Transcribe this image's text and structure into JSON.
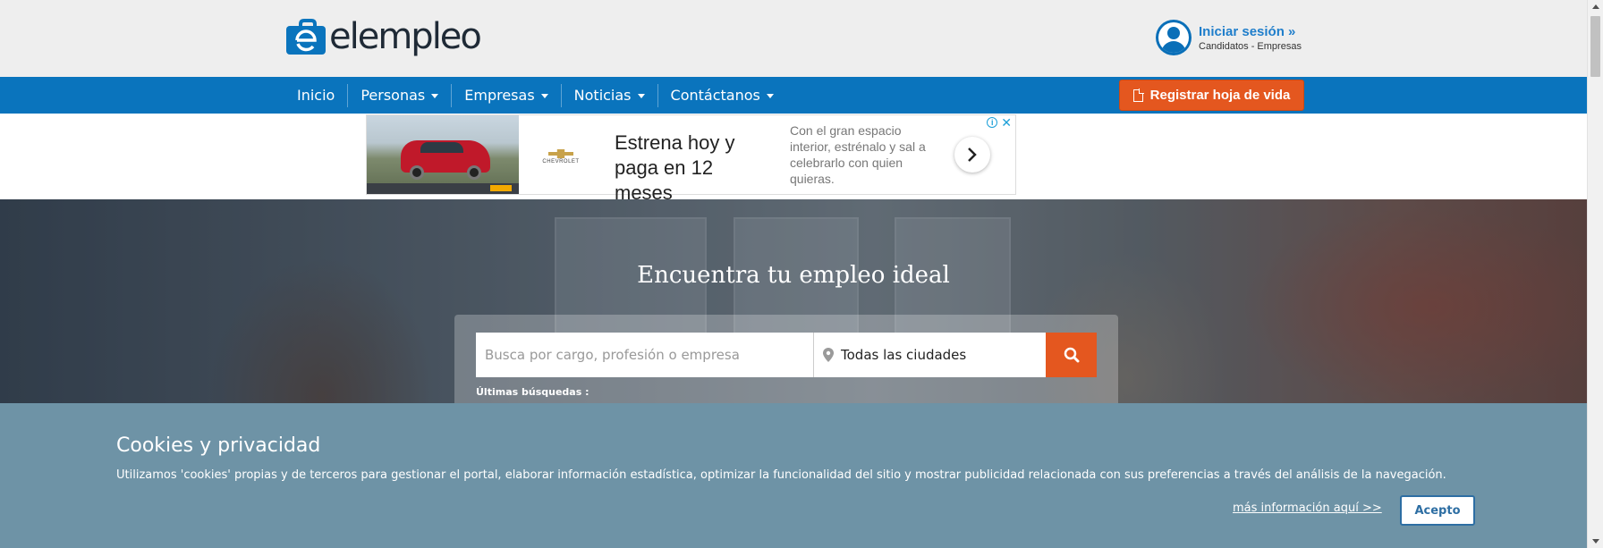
{
  "header": {
    "logo_text": "elempleo",
    "login_title": "Iniciar sesión »",
    "login_subtitle": "Candidatos - Empresas"
  },
  "nav": {
    "items": [
      {
        "label": "Inicio",
        "dropdown": false
      },
      {
        "label": "Personas",
        "dropdown": true
      },
      {
        "label": "Empresas",
        "dropdown": true
      },
      {
        "label": "Noticias",
        "dropdown": true
      },
      {
        "label": "Contáctanos",
        "dropdown": true
      }
    ],
    "register_label": "Registrar hoja de vida"
  },
  "ad": {
    "brand": "CHEVROLET",
    "headline": "Estrena hoy y paga en 12 meses",
    "body": "Con el gran espacio interior, estrénalo y sal a celebrarlo con quien quieras.",
    "info_icon": "info-icon",
    "close_label": "✕"
  },
  "hero": {
    "title": "Encuentra tu empleo ideal",
    "search_placeholder": "Busca por cargo, profesión o empresa",
    "city_value": "Todas las ciudades",
    "recent_label": "Últimas búsquedas :"
  },
  "cookies": {
    "title": "Cookies y privacidad",
    "text": "Utilizamos 'cookies' propias y de terceros para gestionar el portal, elaborar información estadística, optimizar la funcionalidad del sitio y mostrar publicidad relacionada con sus preferencias a través del análisis de la navegación.",
    "more_link": "más información aquí >>",
    "accept_label": "Acepto"
  },
  "colors": {
    "nav_blue": "#0a74bd",
    "accent_orange": "#e4571f",
    "cookie_bg": "#6e93a6",
    "header_bg": "#eeeeee"
  }
}
